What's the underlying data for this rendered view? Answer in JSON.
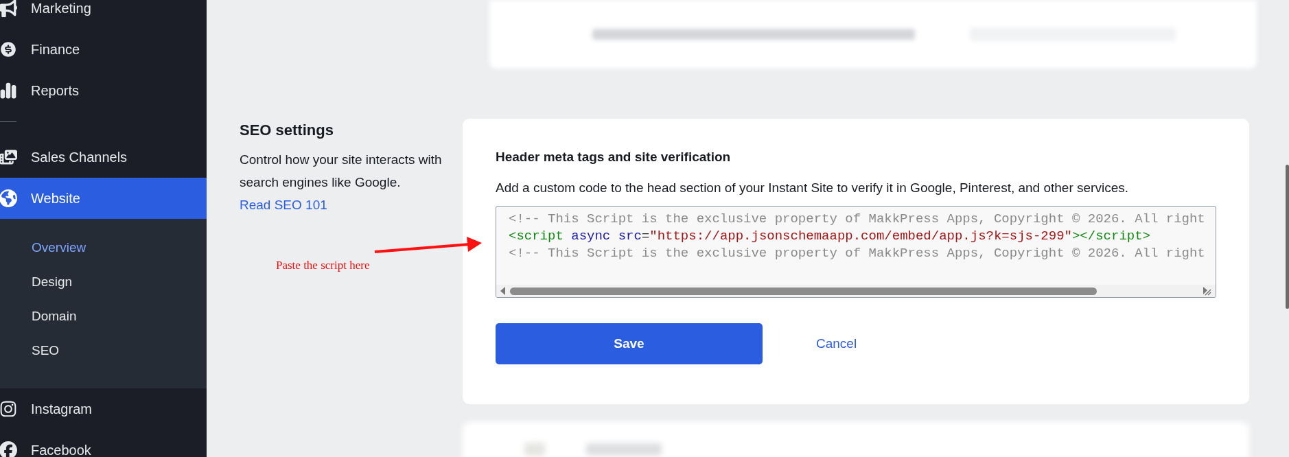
{
  "sidebar": {
    "items": [
      {
        "label": "Marketing",
        "selected": false
      },
      {
        "label": "Finance",
        "selected": false
      },
      {
        "label": "Reports",
        "selected": false
      },
      {
        "kind": "divider"
      },
      {
        "label": "Sales Channels",
        "selected": false
      },
      {
        "label": "Website",
        "selected": true,
        "expanded": true,
        "children": [
          {
            "label": "Overview",
            "selected": true
          },
          {
            "label": "Design",
            "selected": false
          },
          {
            "label": "Domain",
            "selected": false
          },
          {
            "label": "SEO",
            "selected": false
          }
        ]
      },
      {
        "label": "Instagram",
        "selected": false
      },
      {
        "label": "Facebook",
        "selected": false
      }
    ]
  },
  "section": {
    "title": "SEO settings",
    "description": "Control how your site interacts with search engines like Google.",
    "link": "Read SEO 101"
  },
  "card": {
    "heading": "Header meta tags and site verification",
    "description": "Add a custom code to the head section of your Instant Site to verify it in Google, Pinterest, and other services.",
    "code_lines": [
      [
        {
          "kind": "comment",
          "text": "<!-- This Script is the exclusive property of MakkPress Apps, Copyright © 2026. All right"
        }
      ],
      [
        {
          "kind": "tag",
          "text": "<script"
        },
        {
          "kind": "attr",
          "text": " async"
        },
        {
          "kind": "attr",
          "text": " src"
        },
        {
          "kind": "plain",
          "text": "="
        },
        {
          "kind": "string",
          "text": "\"https://app.jsonschemaapp.com/embed/app.js?k=sjs-299\""
        },
        {
          "kind": "tag",
          "text": "></script>"
        }
      ],
      [
        {
          "kind": "comment",
          "text": "<!-- This Script is the exclusive property of MakkPress Apps, Copyright © 2026. All right"
        }
      ]
    ],
    "save": "Save",
    "cancel": "Cancel"
  },
  "annotation": {
    "text": "Paste the script here"
  }
}
